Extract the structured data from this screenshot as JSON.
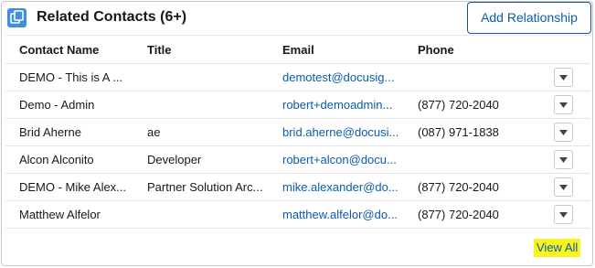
{
  "card": {
    "title": "Related Contacts (6+)",
    "add_button_label": "Add Relationship",
    "icon": "contacts-object-icon",
    "footer_link": "View All"
  },
  "table": {
    "columns": [
      "Contact Name",
      "Title",
      "Email",
      "Phone"
    ],
    "rows": [
      {
        "name": "DEMO - This is A ...",
        "title": "",
        "email": "demotest@docusig...",
        "phone": ""
      },
      {
        "name": "Demo - Admin",
        "title": "",
        "email": "robert+demoadmin...",
        "phone": "(877) 720-2040"
      },
      {
        "name": "Brid Aherne",
        "title": "ae",
        "email": "brid.aherne@docusi...",
        "phone": "(087) 971-1838"
      },
      {
        "name": "Alcon Alconito",
        "title": "Developer",
        "email": "robert+alcon@docu...",
        "phone": ""
      },
      {
        "name": "DEMO - Mike Alex...",
        "title": "Partner Solution Arc...",
        "email": "mike.alexander@do...",
        "phone": "(877) 720-2040"
      },
      {
        "name": "Matthew Alfelor",
        "title": "",
        "email": "matthew.alfelor@do...",
        "phone": "(877) 720-2040"
      }
    ],
    "row_action_icon": "chevron-down-icon"
  },
  "colors": {
    "accent": "#0b5cab",
    "icon_bg": "#3e8fe0",
    "highlight": "#f7f51b",
    "border": "#c9c9c9"
  }
}
